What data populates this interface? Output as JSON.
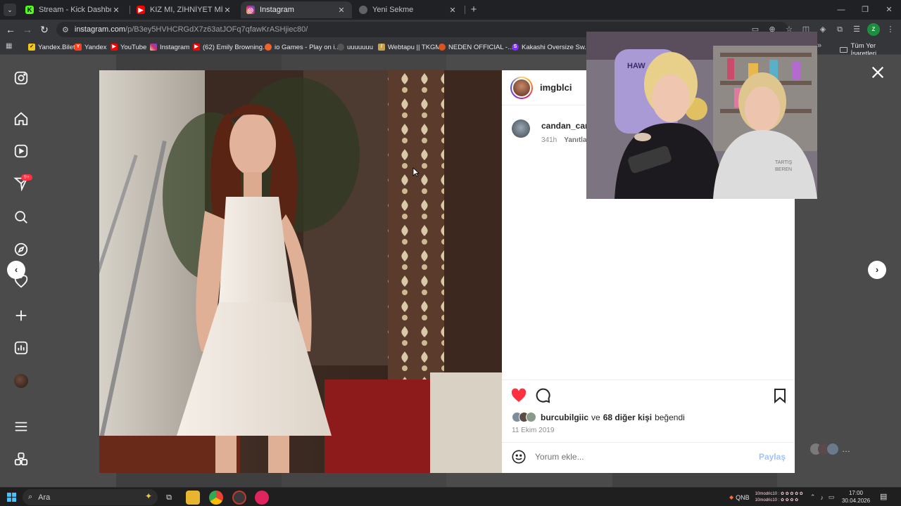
{
  "browser": {
    "tabs": [
      {
        "title": "Stream - Kick Dashboard",
        "favicon": "kick-icon",
        "color": "#53fc18"
      },
      {
        "title": "KIZ MI, ZİHNİYET Mİ? ÇİRKİN D",
        "favicon": "youtube-icon",
        "color": "#ff0000"
      },
      {
        "title": "Instagram",
        "favicon": "instagram-icon",
        "color": "#e1306c"
      },
      {
        "title": "Yeni Sekme",
        "favicon": "chrome-icon",
        "color": "#bdc1c6"
      }
    ],
    "active_tab": 2,
    "url_host": "instagram.com",
    "url_path": "/p/B3ey5HVHCRGdX7z63atJOFq7qfawKrASHjiec80/",
    "bookmarks": [
      {
        "label": "Yandex.Bilet",
        "favicon": "check-icon",
        "color": "#f5c518"
      },
      {
        "label": "Yandex",
        "favicon": "yandex-icon",
        "color": "#fc3f1d"
      },
      {
        "label": "YouTube",
        "favicon": "youtube-icon",
        "color": "#ff0000"
      },
      {
        "label": "Instagram",
        "favicon": "instagram-icon",
        "color": "#e1306c"
      },
      {
        "label": "(62) Emily Browning...",
        "favicon": "youtube-icon",
        "color": "#ff0000"
      },
      {
        "label": "io Games - Play on i...",
        "favicon": "io-games-icon",
        "color": "#f0642c"
      },
      {
        "label": "uuuuuuu",
        "favicon": "github-icon",
        "color": "#555555"
      },
      {
        "label": "Webtapu || TKGM",
        "favicon": "tkgm-icon",
        "color": "#c8a24a"
      },
      {
        "label": "NEDEN OFFICIAL -...",
        "favicon": "neden-icon",
        "color": "#d9541e"
      },
      {
        "label": "Kakashi Oversize Sw...",
        "favicon": "s-icon",
        "color": "#7b2ff7"
      }
    ],
    "all_bookmarks_label": "Tüm Yer İşaretleri"
  },
  "instagram": {
    "notification_badge": "9+",
    "post": {
      "author": "imgblci",
      "comment": {
        "user": "candan_canc",
        "time": "341h",
        "reply_label": "Yanıtla"
      },
      "likes": {
        "first_user": "burcubilgiic",
        "connector": "ve",
        "others": "68 diğer kişi",
        "suffix": "beğendi"
      },
      "date": "11 Ekim 2019",
      "comment_placeholder": "Yorum ekle...",
      "share_label": "Paylaş"
    }
  },
  "taskbar": {
    "search_placeholder": "Ara",
    "weather_label": "QNB",
    "chat_line1": "10modric10 : ✿ ✿ ✿ ✿ ✿",
    "chat_line2": "10modric10 : ✿ ✿ ✿ ✿",
    "time": "17:00",
    "date": "30.04.2026"
  },
  "colors": {
    "like_red": "#ff3040",
    "share_blue": "#a3c3f5",
    "ig_text": "#262626",
    "muted": "#8e8e8e"
  }
}
